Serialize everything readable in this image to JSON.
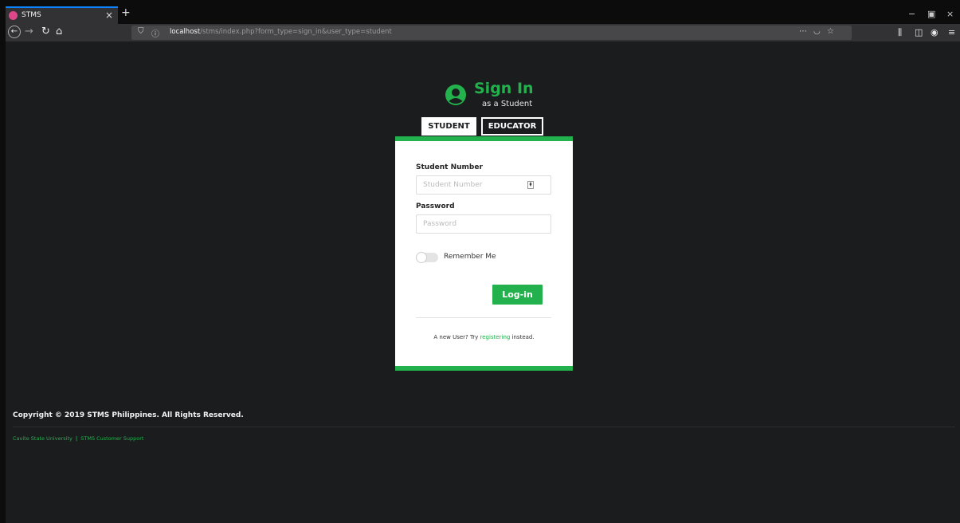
{
  "browser": {
    "tab_title": "STMS",
    "tab_close": "×",
    "new_tab": "+",
    "window_minimize": "−",
    "window_restore": "▫",
    "window_close": "×",
    "url_host": "localhost",
    "url_path": "/stms/index.php?form_type=sign_in&user_type=student",
    "accent_color": "#0a84ff"
  },
  "header": {
    "title": "Sign In",
    "subtitle": "as a Student"
  },
  "roles": {
    "student_label": "STUDENT",
    "educator_label": "EDUCATOR",
    "active": "STUDENT"
  },
  "form": {
    "student_number_label": "Student Number",
    "student_number_placeholder": "Student Number",
    "password_label": "Password",
    "password_placeholder": "Password",
    "remember_label": "Remember Me",
    "login_label": "Log-in",
    "new_user_prefix": "A new User? Try ",
    "new_user_link": "registering",
    "new_user_suffix": " instead."
  },
  "footer": {
    "copyright": "Copyright © 2019 STMS Philippines. All Rights Reserved.",
    "link_1": "Cavite State University",
    "separator": "|",
    "link_2": "STMS Customer Support"
  },
  "colors": {
    "brand_green": "#22b14c",
    "page_bg": "#1b1c1e",
    "card_bg": "#ffffff"
  },
  "icons": {
    "user": "user-circle-icon",
    "back": "arrow-left-icon",
    "forward": "arrow-right-icon",
    "reload": "reload-icon",
    "home": "home-icon",
    "shield": "shield-icon",
    "info": "info-icon",
    "more": "ellipsis-icon",
    "pocket": "pocket-icon",
    "star": "star-icon",
    "library": "library-icon",
    "sidebar": "sidebar-icon",
    "account": "account-icon",
    "menu": "hamburger-menu-icon"
  }
}
